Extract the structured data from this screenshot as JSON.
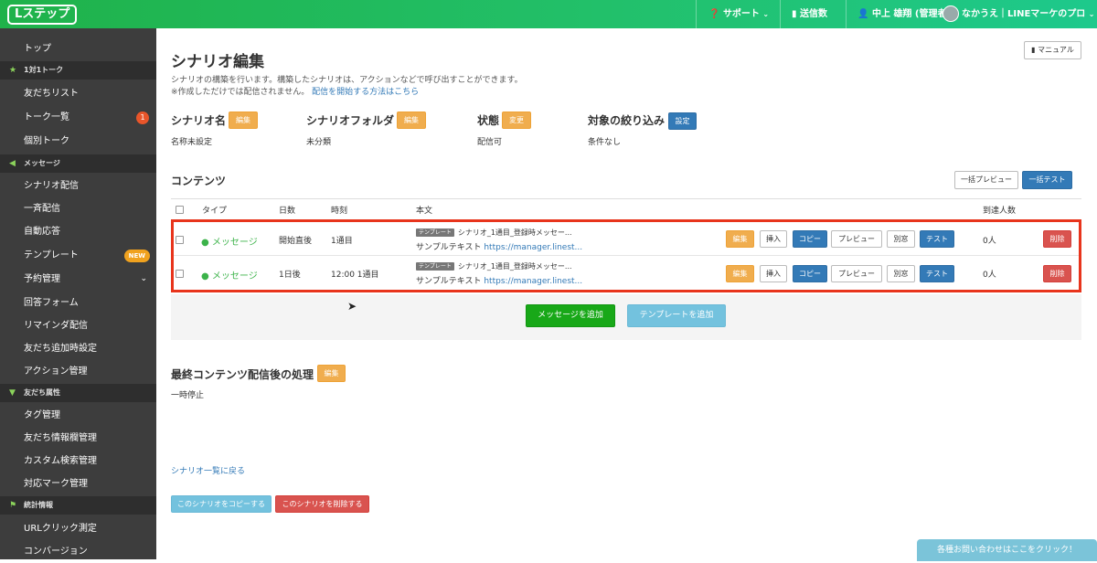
{
  "header": {
    "logo": "Lステップ",
    "support": "サポート",
    "send_count": "送信数",
    "user": "中上 雄翔 (管理者)",
    "account": "なかうえ｜LINEマーケのプロ"
  },
  "sidebar": {
    "top": "トップ",
    "sec_talk": "1対1トーク",
    "friends_list": "友だちリスト",
    "talk_list": "トーク一覧",
    "talk_badge": "1",
    "individual_talk": "個別トーク",
    "sec_message": "メッセージ",
    "scenario": "シナリオ配信",
    "broadcast": "一斉配信",
    "auto_reply": "自動応答",
    "template": "テンプレート",
    "new_badge": "NEW",
    "reservation": "予約管理",
    "answer_form": "回答フォーム",
    "reminder": "リマインダ配信",
    "friend_add": "友だち追加時設定",
    "action": "アクション管理",
    "sec_attr": "友だち属性",
    "tag_mgmt": "タグ管理",
    "friend_info": "友だち情報欄管理",
    "custom_search": "カスタム検索管理",
    "mark_mgmt": "対応マーク管理",
    "sec_stats": "統計情報",
    "url_click": "URLクリック測定",
    "conversion": "コンバージョン"
  },
  "page": {
    "title": "シナリオ編集",
    "desc1": "シナリオの構築を行います。構築したシナリオは、アクションなどで呼び出すことができます。",
    "desc2": "※作成しただけでは配信されません。",
    "desc2_link": "配信を開始する方法はこちら",
    "manual": "マニュアル"
  },
  "settings": {
    "name_label": "シナリオ名",
    "name_btn": "編集",
    "name_value": "名称未設定",
    "folder_label": "シナリオフォルダ",
    "folder_btn": "編集",
    "folder_value": "未分類",
    "status_label": "状態",
    "status_btn": "変更",
    "status_value": "配信可",
    "filter_label": "対象の絞り込み",
    "filter_btn": "設定",
    "filter_value": "条件なし"
  },
  "contents": {
    "title": "コンテンツ",
    "bulk_preview": "一括プレビュー",
    "bulk_test": "一括テスト",
    "columns": {
      "type": "タイプ",
      "days": "日数",
      "time": "時刻",
      "body": "本文",
      "reach": "到達人数"
    },
    "rows": [
      {
        "type": "メッセージ",
        "days": "開始直後",
        "time": "1通目",
        "tag": "テンプレート",
        "body_title": "シナリオ_1通目_登録時メッセー...",
        "body_text": "サンプルテキスト",
        "body_link": "https://manager.linest...",
        "reach": "0人"
      },
      {
        "type": "メッセージ",
        "days": "1日後",
        "time": "12:00 1通目",
        "tag": "テンプレート",
        "body_title": "シナリオ_1通目_登録時メッセー...",
        "body_text": "サンプルテキスト",
        "body_link": "https://manager.linest...",
        "reach": "0人"
      }
    ],
    "actions": {
      "edit": "編集",
      "insert": "挿入",
      "copy": "コピー",
      "preview": "プレビュー",
      "separate": "別窓",
      "test": "テスト",
      "delete": "削除"
    },
    "add_message": "メッセージを追加",
    "add_template": "テンプレートを追加"
  },
  "final": {
    "title": "最終コンテンツ配信後の処理",
    "edit": "編集",
    "value": "一時停止"
  },
  "footer": {
    "back_link": "シナリオ一覧に戻る",
    "copy_scenario": "このシナリオをコピーする",
    "delete_scenario": "このシナリオを削除する",
    "contact": "各種お問い合わせはここをクリック！"
  },
  "colors": {
    "header_green": "#22c06a",
    "sidebar_bg": "#3d3d3d",
    "highlight_red": "#e8341c"
  }
}
